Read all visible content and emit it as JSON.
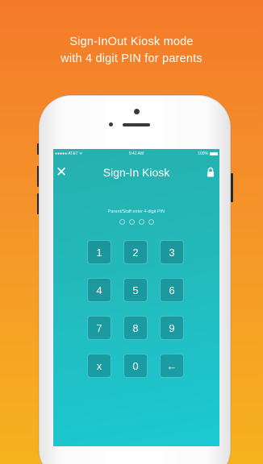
{
  "promo": {
    "line1": "Sign-InOut Kiosk mode",
    "line2": "with 4 digit PIN for parents"
  },
  "status_bar": {
    "carrier": "●●●●● AT&T ᯤ",
    "time": "9:41 AM",
    "battery": "100%"
  },
  "header": {
    "close_icon": "close-icon",
    "title": "Sign-In Kiosk",
    "lock_icon": "lock-icon"
  },
  "pin": {
    "label": "Parent/Staff enter 4-digit PIN",
    "length": 4,
    "entered": 0
  },
  "keypad": {
    "keys": [
      "1",
      "2",
      "3",
      "4",
      "5",
      "6",
      "7",
      "8",
      "9",
      "x",
      "0",
      "←"
    ]
  },
  "colors": {
    "background_top": "#f47a2a",
    "background_bottom": "#f6b21e",
    "screen_top": "#26b0ae",
    "screen_bottom": "#1cc9d3"
  }
}
